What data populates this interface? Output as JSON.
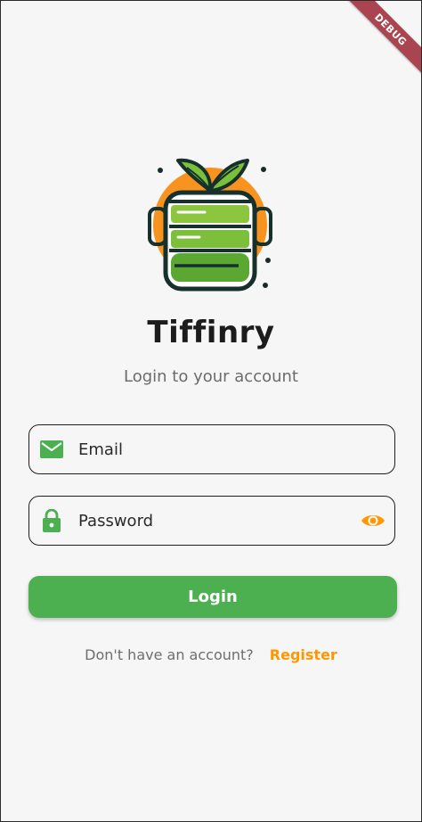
{
  "debug_banner": "DEBUG",
  "app": {
    "title": "Tiffinry",
    "subtitle": "Login to your account"
  },
  "form": {
    "email": {
      "label": "Email",
      "icon": "mail-icon"
    },
    "password": {
      "label": "Password",
      "icon": "lock-icon",
      "toggle_icon": "eye-icon"
    },
    "login_label": "Login"
  },
  "register": {
    "prompt": "Don't have an account?",
    "link_label": "Register"
  },
  "colors": {
    "primary_green": "#4caf50",
    "accent_orange": "#ff9800",
    "background": "#f6f6f6",
    "debug_ribbon": "#a94450"
  }
}
